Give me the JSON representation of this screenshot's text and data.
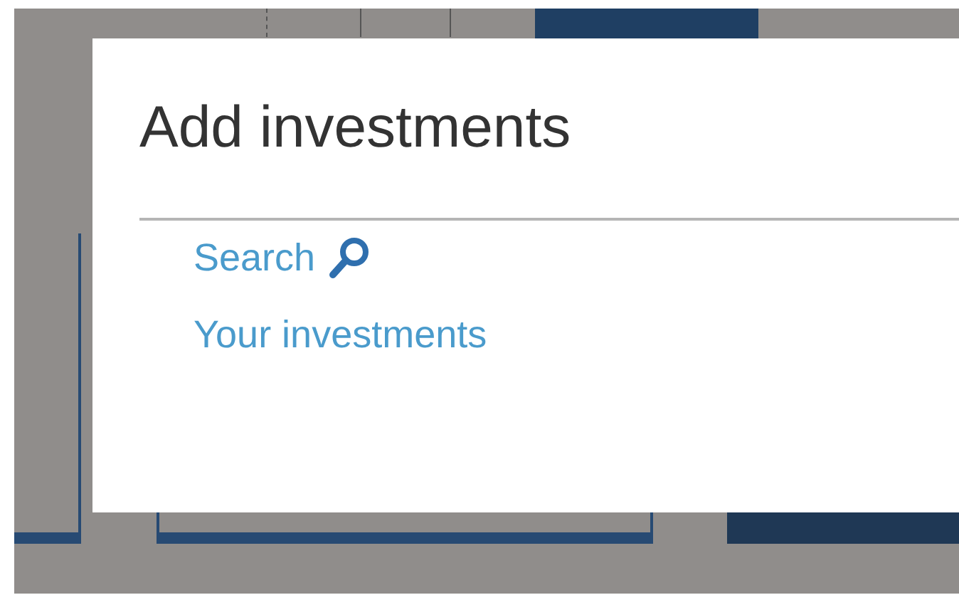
{
  "dialog": {
    "title": "Add investments",
    "links": [
      {
        "label": "Search",
        "kind": "search"
      },
      {
        "label": "Your investments",
        "kind": "plain"
      }
    ]
  }
}
